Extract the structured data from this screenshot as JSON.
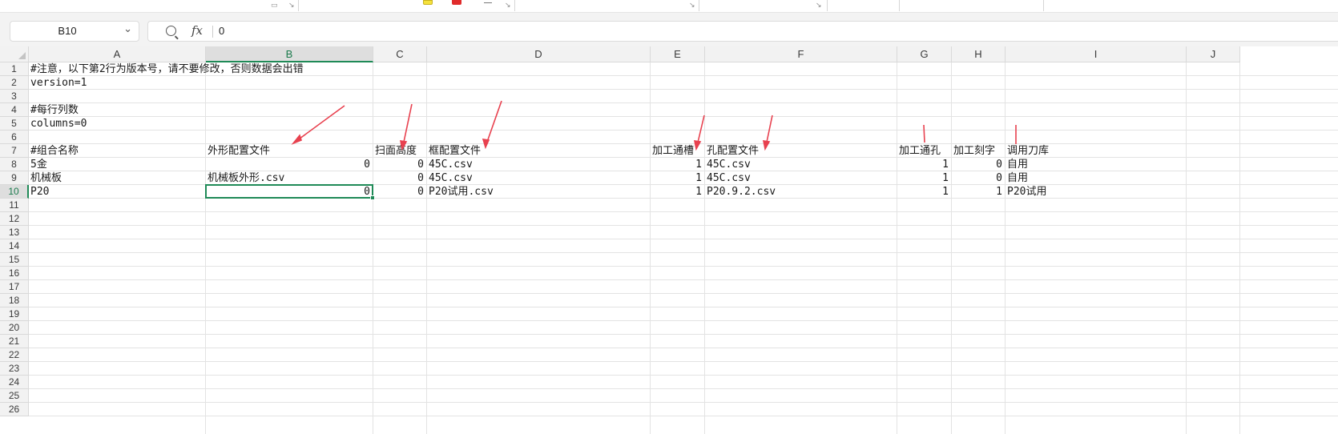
{
  "name_box": {
    "reference": "B10"
  },
  "formula_bar": {
    "value": "0"
  },
  "columns": [
    "A",
    "B",
    "C",
    "D",
    "E",
    "F",
    "G",
    "H",
    "I",
    "J"
  ],
  "selected_column": "B",
  "rows": [
    "1",
    "2",
    "3",
    "4",
    "5",
    "6",
    "7",
    "8",
    "9",
    "10",
    "11",
    "12",
    "13",
    "14",
    "15",
    "16",
    "17",
    "18",
    "19",
    "20",
    "21",
    "22",
    "23",
    "24",
    "25",
    "26"
  ],
  "selected_row": "10",
  "cells": {
    "A1": "#注意，以下第2行为版本号，请不要修改，否则数据会出错",
    "A2": "version=1",
    "A4": "#每行列数",
    "A5": "columns=0",
    "A7": "#组合名称",
    "B7": "外形配置文件",
    "C7": "扫面高度",
    "D7": "框配置文件",
    "E7": "加工通槽",
    "F7": "孔配置文件",
    "G7": "加工通孔",
    "H7": "加工刻字",
    "I7": "调用刀库",
    "A8": "5金",
    "B8": "0",
    "C8": "0",
    "D8": "45C.csv",
    "E8": "1",
    "F8": "45C.csv",
    "G8": "1",
    "H8": "0",
    "I8": "自用",
    "A9": "机械板",
    "B9": "机械板外形.csv",
    "C9": "0",
    "D9": "45C.csv",
    "E9": "1",
    "F9": "45C.csv",
    "G9": "1",
    "H9": "0",
    "I9": "自用",
    "A10": "P20",
    "B10": "0",
    "C10": "0",
    "D10": "P20试用.csv",
    "E10": "1",
    "F10": "P20.9.2.csv",
    "G10": "1",
    "H10": "1",
    "I10": "P20试用"
  },
  "colors": {
    "selection": "#1f8a57",
    "annotation_arrow": "#e8414f",
    "header_bg": "#f2f2f2"
  },
  "icons": [
    "zoom-icon",
    "fx-icon",
    "dropdown-caret-icon",
    "select-all-corner-icon"
  ]
}
